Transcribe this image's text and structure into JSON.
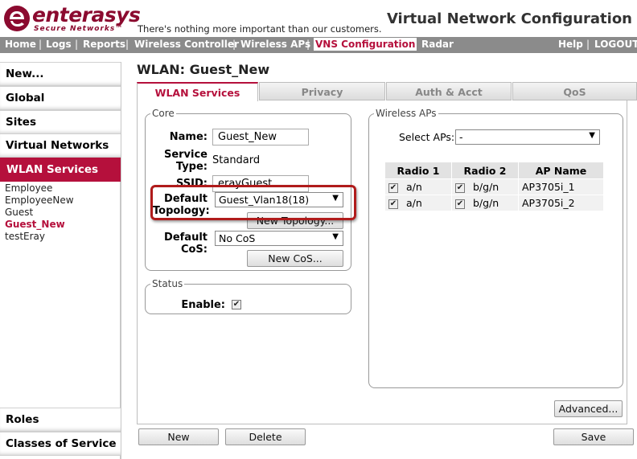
{
  "header": {
    "brand": "enterasys",
    "brand_sub": "Secure Networks™",
    "tagline": "There's nothing more important than our customers.",
    "app_title": "Virtual Network Configuration"
  },
  "nav": {
    "items": [
      "Home",
      "Logs",
      "Reports",
      "Wireless Controller",
      "Wireless APs",
      "VNS Configuration",
      "Radar"
    ],
    "active": "VNS Configuration",
    "right": [
      "Help",
      "LOGOUT"
    ]
  },
  "sidebar": {
    "top": [
      "New...",
      "Global",
      "Sites",
      "Virtual Networks",
      "WLAN Services"
    ],
    "selected": "WLAN Services",
    "services": [
      "Employee",
      "EmployeeNew",
      "Guest",
      "Guest_New",
      "testEray"
    ],
    "current": "Guest_New",
    "bottom": [
      "Roles",
      "Classes of Service"
    ]
  },
  "page": {
    "title": "WLAN: Guest_New"
  },
  "tabs": [
    "WLAN Services",
    "Privacy",
    "Auth & Acct",
    "QoS"
  ],
  "core": {
    "legend": "Core",
    "name_label": "Name:",
    "name_value": "Guest_New",
    "service_type_label": "Service Type:",
    "service_type_value": "Standard",
    "ssid_label": "SSID:",
    "ssid_value": "erayGuest",
    "topology_label": "Default Topology:",
    "topology_value": "Guest_Vlan18(18)",
    "new_topology": "New Topology...",
    "cos_label": "Default CoS:",
    "cos_value": "No CoS",
    "new_cos": "New CoS..."
  },
  "status": {
    "legend": "Status",
    "enable_label": "Enable:",
    "enabled": true
  },
  "aps": {
    "legend": "Wireless APs",
    "select_label": "Select APs:",
    "select_value": "-",
    "columns": [
      "Radio 1",
      "Radio 2",
      "AP Name"
    ],
    "rows": [
      {
        "r1": "a/n",
        "r2": "b/g/n",
        "name": "AP3705i_1"
      },
      {
        "r1": "a/n",
        "r2": "b/g/n",
        "name": "AP3705i_2"
      }
    ],
    "advanced": "Advanced..."
  },
  "footer": {
    "new": "New",
    "delete": "Delete",
    "save": "Save"
  },
  "colors": {
    "brand": "#8b0a2f",
    "accent": "#b5103c",
    "nav_bg": "#8b8b8b",
    "highlight": "#b01b1b"
  }
}
